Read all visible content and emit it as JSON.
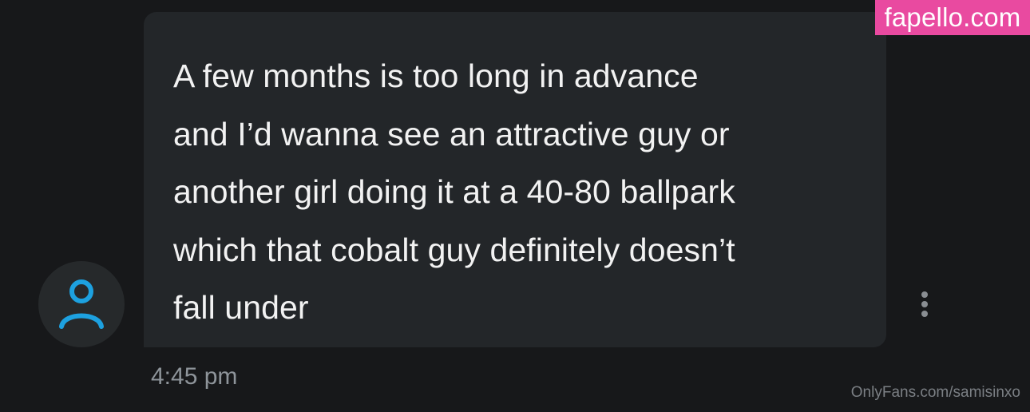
{
  "message": {
    "text": "A few months is too long in advance\nand I’d wanna see an attractive guy or\nanother girl doing it at a 40-80 ballpark\nwhich that cobalt guy definitely doesn’t\nfall under",
    "timestamp": "4:45 pm"
  },
  "avatar": {
    "icon": "person-icon",
    "color": "#1da1e0"
  },
  "actions": {
    "more_icon": "more-vertical-icon"
  },
  "watermarks": {
    "top_right": "fapello.com",
    "bottom_right": "OnlyFans.com/samisinxo"
  },
  "colors": {
    "background": "#17181a",
    "bubble": "#232629",
    "text": "#f2f2f2",
    "timestamp": "#8e949a",
    "watermark_bg": "#e94aa0"
  }
}
